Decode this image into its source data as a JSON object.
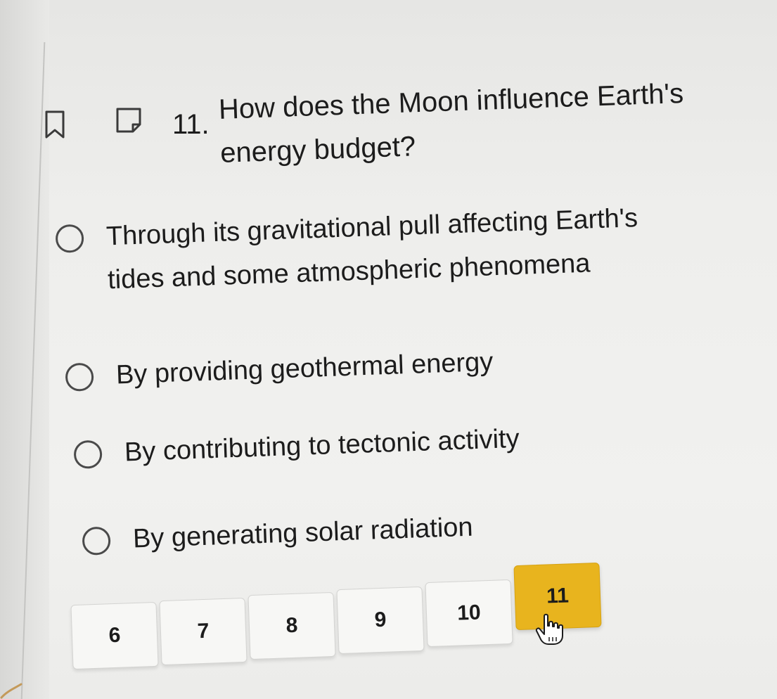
{
  "question": {
    "number": "11.",
    "text": "How does the Moon influence Earth's energy budget?"
  },
  "options": [
    {
      "label": "Through its gravitational pull affecting Earth's tides and some atmospheric phenomena"
    },
    {
      "label": "By providing geothermal energy"
    },
    {
      "label": "By contributing to tectonic activity"
    },
    {
      "label": "By generating solar radiation"
    }
  ],
  "navigation": {
    "pages": [
      "6",
      "7",
      "8",
      "9",
      "10",
      "11"
    ],
    "current": "11"
  },
  "colors": {
    "active_page": "#e8b41e",
    "text": "#1c1c1c",
    "background": "#efefed"
  },
  "icons": {
    "bookmark": "bookmark-icon",
    "note": "note-icon",
    "cursor": "hand-pointer-icon"
  }
}
